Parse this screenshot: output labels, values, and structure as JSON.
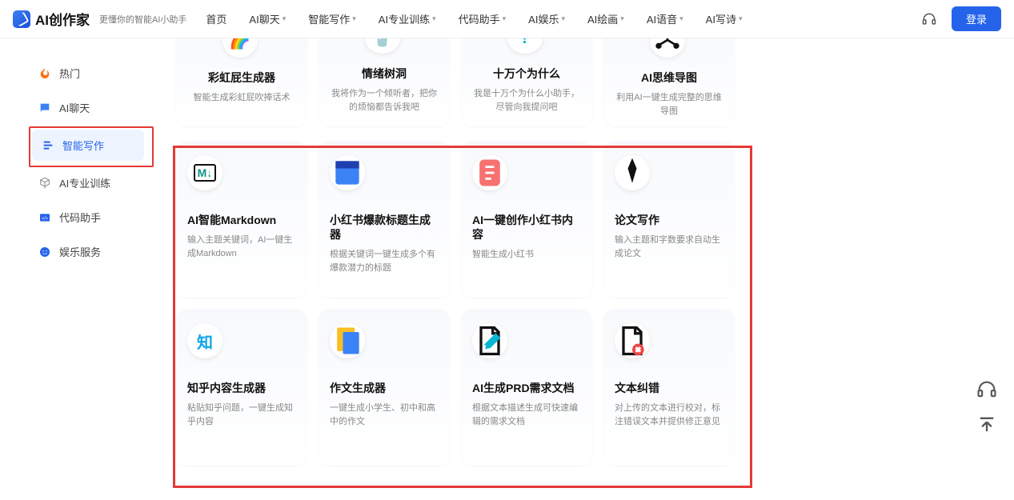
{
  "header": {
    "logo_text": "AI创作家",
    "tagline": "更懂你的智能AI小助手",
    "nav": [
      "首页",
      "AI聊天",
      "智能写作",
      "AI专业训练",
      "代码助手",
      "AI娱乐",
      "AI绘画",
      "AI语音",
      "AI写诗"
    ],
    "nav_dropdown": [
      false,
      true,
      true,
      true,
      true,
      true,
      true,
      true,
      true
    ],
    "login": "登录"
  },
  "sidebar": {
    "items": [
      {
        "label": "热门",
        "icon": "fire"
      },
      {
        "label": "AI聊天",
        "icon": "chat"
      },
      {
        "label": "智能写作",
        "icon": "edit",
        "active": true
      },
      {
        "label": "AI专业训练",
        "icon": "cube"
      },
      {
        "label": "代码助手",
        "icon": "code"
      },
      {
        "label": "娱乐服务",
        "icon": "smile"
      }
    ]
  },
  "cards_row1": [
    {
      "title": "彩虹屁生成器",
      "desc": "智能生成彩虹屁吹捧话术",
      "icon": "rainbow"
    },
    {
      "title": "情绪树洞",
      "desc": "我将作为一个倾听者，把你的烦恼都告诉我吧",
      "icon": "cup"
    },
    {
      "title": "十万个为什么",
      "desc": "我是十万个为什么小助手，尽管向我提问吧",
      "icon": "question"
    },
    {
      "title": "AI思维导图",
      "desc": "利用AI一键生成完整的思维导图",
      "icon": "mindmap"
    }
  ],
  "cards_row2": [
    {
      "title": "AI智能Markdown",
      "desc": "输入主题关键词，AI一键生成Markdown",
      "icon": "markdown"
    },
    {
      "title": "小红书爆款标题生成器",
      "desc": "根据关键词一键生成多个有爆款潜力的标题",
      "icon": "window"
    },
    {
      "title": "AI一键创作小红书内容",
      "desc": "智能生成小红书",
      "icon": "note"
    },
    {
      "title": "论文写作",
      "desc": "输入主题和字数要求自动生成论文",
      "icon": "pen"
    }
  ],
  "cards_row3": [
    {
      "title": "知乎内容生成器",
      "desc": "粘贴知乎问题，一键生成知乎内容",
      "icon": "zhi"
    },
    {
      "title": "作文生成器",
      "desc": "一键生成小学生、初中和高中的作文",
      "icon": "doc"
    },
    {
      "title": "AI生成PRD需求文档",
      "desc": "根据文本描述生成可快速编辑的需求文档",
      "icon": "pencil"
    },
    {
      "title": "文本纠错",
      "desc": "对上传的文本进行校对，标注错误文本并提供修正意见",
      "icon": "doc-x"
    }
  ]
}
